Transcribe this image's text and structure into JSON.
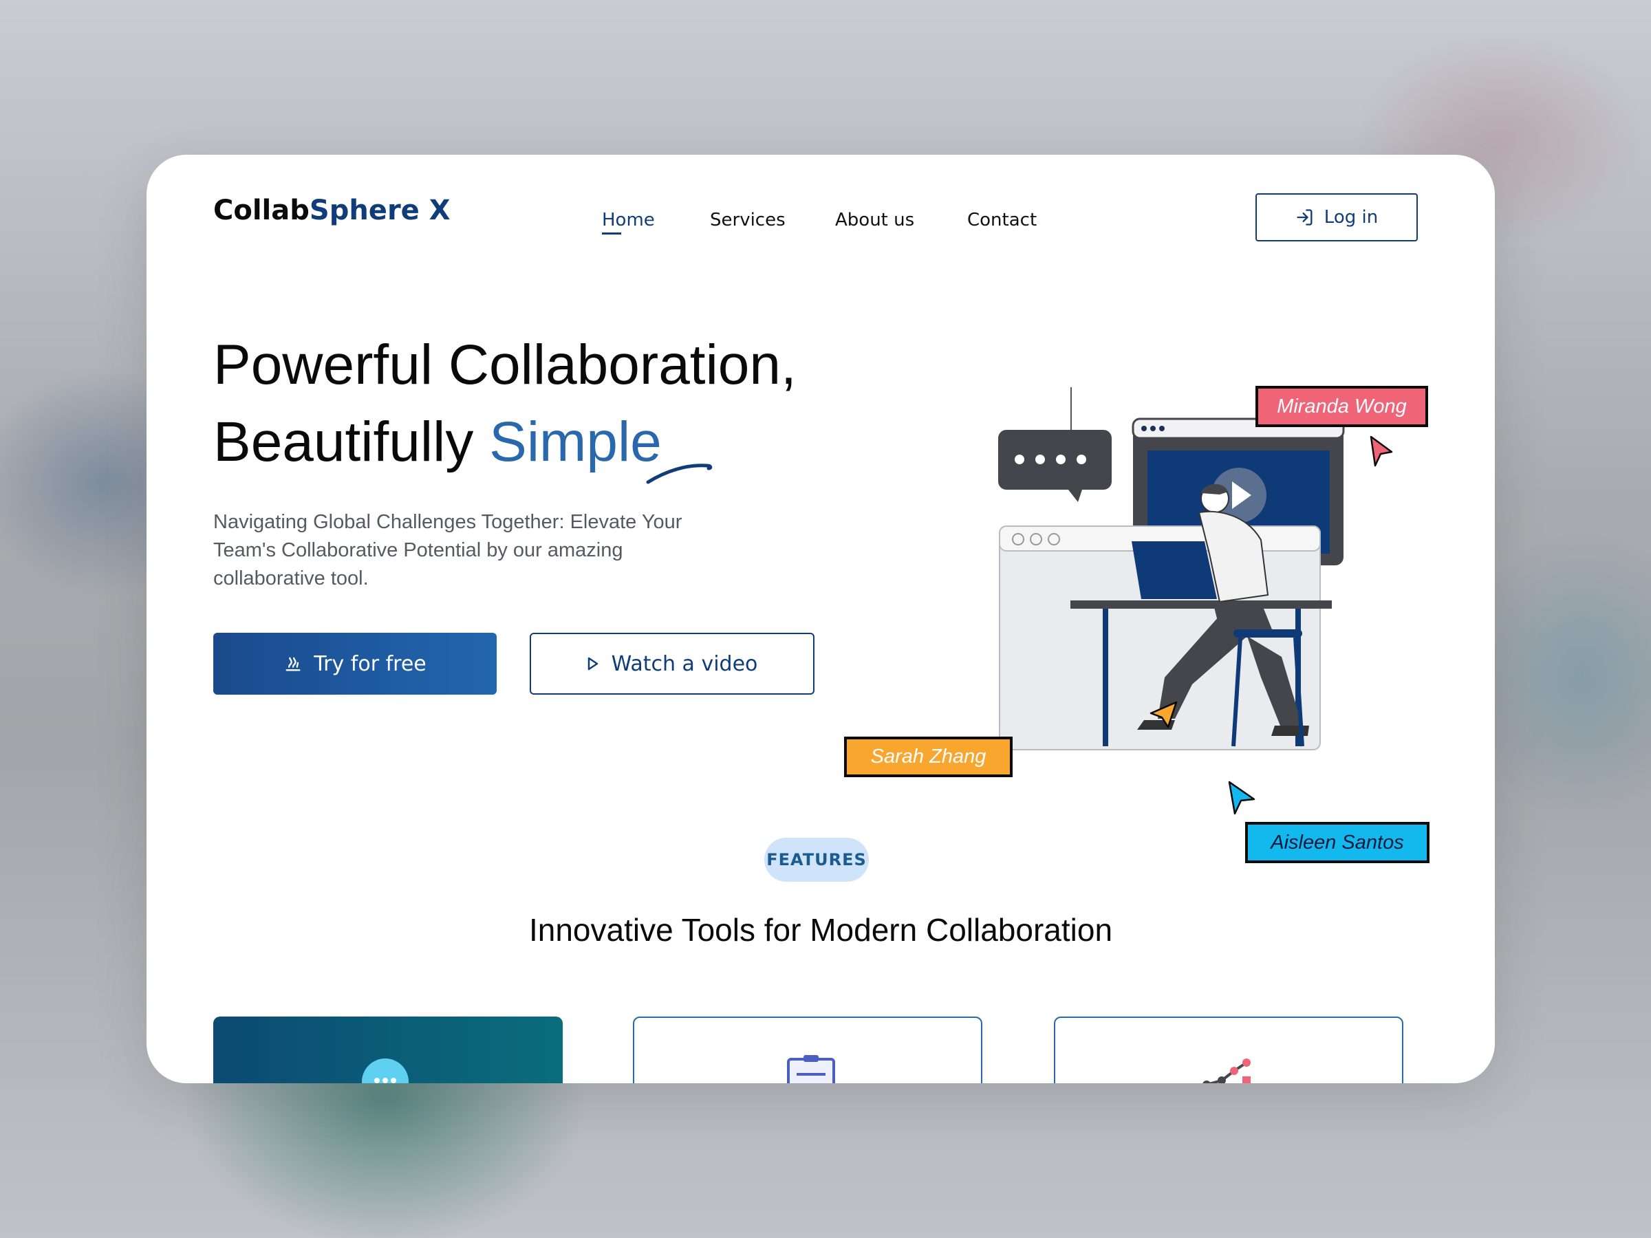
{
  "brand": {
    "name_part1": "Collab",
    "name_part2": "Sphere X"
  },
  "nav": {
    "items": [
      "Home",
      "Services",
      "About us",
      "Contact"
    ],
    "active": "Home"
  },
  "login": {
    "label": "Log in"
  },
  "hero": {
    "title_line1": "Powerful Collaboration,",
    "title_line2_prefix": "Beautifully ",
    "title_line2_highlight": "Simple",
    "subtitle": "Navigating Global Challenges Together: Elevate Your Team's Collaborative Potential by our amazing collaborative tool.",
    "primary_button": "Try for free",
    "secondary_button": "Watch a video"
  },
  "cursors": [
    {
      "name": "Miranda Wong",
      "color": "#f06478"
    },
    {
      "name": "Sarah Zhang",
      "color": "#f9a62e"
    },
    {
      "name": "Aisleen Santos",
      "color": "#12b8ee"
    }
  ],
  "features": {
    "pill": "FEATURES",
    "title": "Innovative Tools for Modern Collaboration"
  },
  "colors": {
    "brand_navy": "#103d7a",
    "brand_blue": "#2a68ad",
    "pill_bg": "#cfe4fb"
  }
}
